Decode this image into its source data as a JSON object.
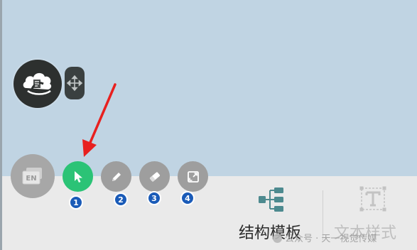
{
  "toolbar": {
    "lang_button": {
      "label": "EN"
    },
    "tools": [
      {
        "name": "select",
        "icon": "cursor-icon",
        "badge": "1",
        "active": true
      },
      {
        "name": "pen",
        "icon": "pen-icon",
        "badge": "2",
        "active": false
      },
      {
        "name": "eraser",
        "icon": "eraser-icon",
        "badge": "3",
        "active": false
      },
      {
        "name": "expand",
        "icon": "expand-icon",
        "badge": "4",
        "active": false
      }
    ]
  },
  "bottom_panel": {
    "structure_template_label": "结构模板",
    "text_style_label": "文本样式"
  },
  "watermark": "公众号 · 天一视觉传媒",
  "colors": {
    "canvas_bg": "#c0d4e3",
    "panel_bg": "#eaeaea",
    "active_tool": "#2bc376",
    "inactive_tool": "#9e9e9e",
    "badge": "#1a5bb8",
    "arrow": "#e8201f",
    "structure_icon": "#4d8a8f"
  }
}
